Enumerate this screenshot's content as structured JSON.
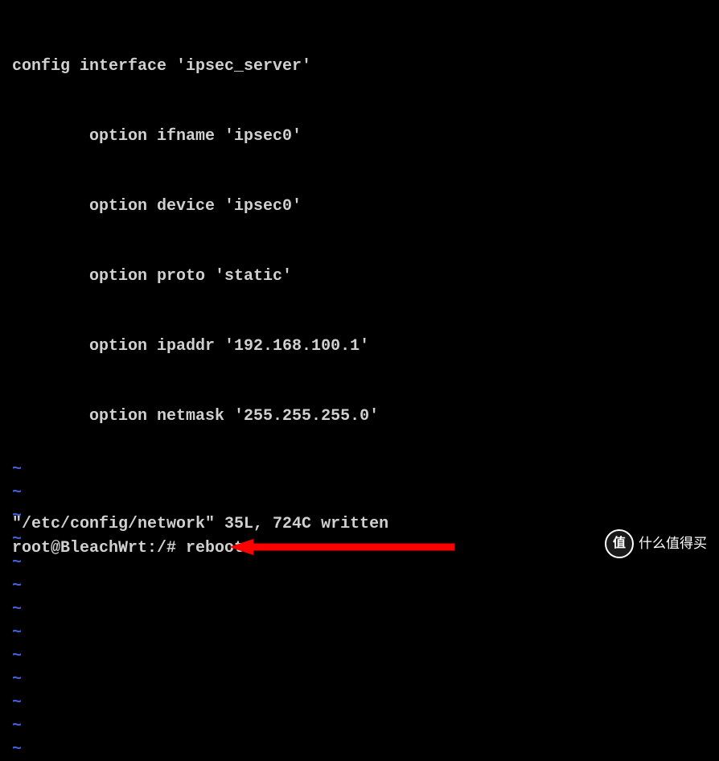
{
  "config": {
    "header": "config interface 'ipsec_server'",
    "options": [
      "        option ifname 'ipsec0'",
      "        option device 'ipsec0'",
      "        option proto 'static'",
      "        option ipaddr '192.168.100.1'",
      "        option netmask '255.255.255.0'"
    ]
  },
  "tilde": "~",
  "status": "\"/etc/config/network\" 35L, 724C written",
  "prompt": "root@BleachWrt:/# reboot",
  "watermark": {
    "badge": "值",
    "text": "什么值得买"
  }
}
